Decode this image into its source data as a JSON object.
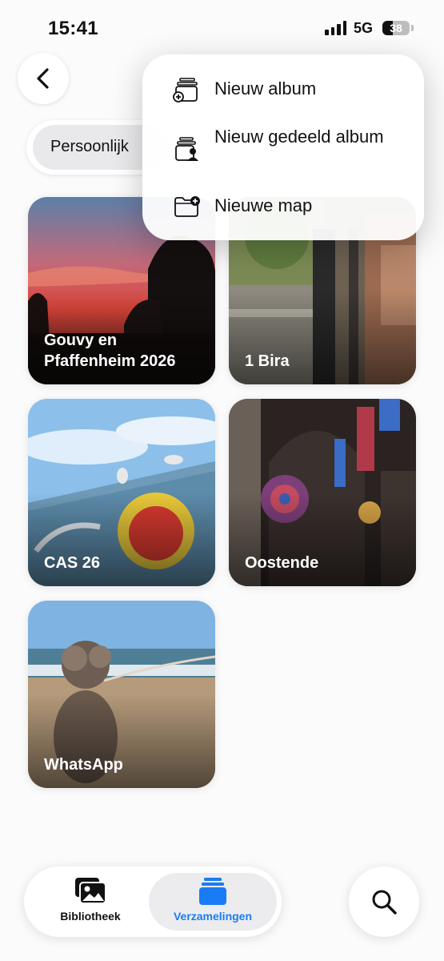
{
  "status_bar": {
    "time": "15:41",
    "network": "5G",
    "battery": "38",
    "battery_level": 0.38
  },
  "nav": {
    "back_icon": "chevron-left-icon"
  },
  "segment": {
    "selected_label": "Persoonlijk"
  },
  "menu": {
    "items": [
      {
        "label": "Nieuw album",
        "icon": "new-album-icon"
      },
      {
        "label": "Nieuw gedeeld album",
        "icon": "shared-album-icon"
      },
      {
        "label": "Nieuwe map",
        "icon": "new-folder-icon"
      }
    ]
  },
  "albums": [
    {
      "title": "Gouvy en Pfaffenheim 2026"
    },
    {
      "title": "1 Bira"
    },
    {
      "title": "CAS 26"
    },
    {
      "title": "Oostende"
    },
    {
      "title": "WhatsApp"
    }
  ],
  "tabbar": {
    "library_label": "Bibliotheek",
    "collections_label": "Verzamelingen",
    "active_color": "#1a7cf4"
  },
  "search": {
    "icon": "search-icon"
  }
}
